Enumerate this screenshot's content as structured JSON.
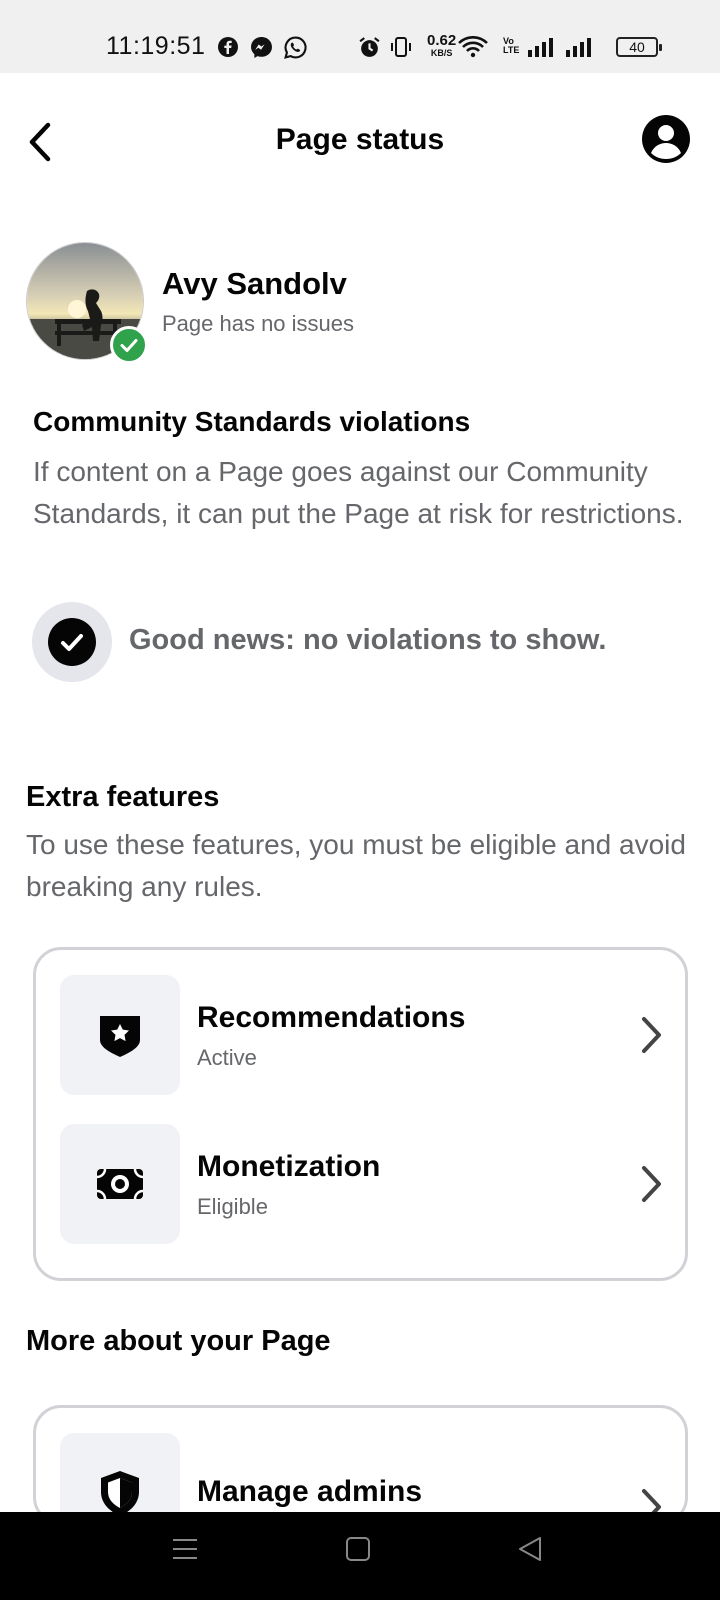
{
  "status_bar": {
    "time": "11:19:51",
    "net_speed_value": "0.62",
    "net_speed_unit": "KB/S",
    "volte_top": "Vo",
    "volte_bottom": "LTE",
    "battery": "40",
    "icons": [
      "facebook-icon",
      "messenger-icon",
      "whatsapp-icon",
      "alarm-icon",
      "vibrate-icon",
      "wifi-icon",
      "signal-icon",
      "signal-icon"
    ]
  },
  "header": {
    "title": "Page status",
    "back_icon": "chevron-left-icon",
    "profile_icon": "account-circle-icon"
  },
  "page": {
    "name": "Avy Sandolv",
    "status": "Page has no issues"
  },
  "community_standards": {
    "title": "Community Standards violations",
    "description": "If content on a Page goes against our Community Standards, it can put the Page at risk for restrictions.",
    "good_news": "Good news: no violations to show."
  },
  "extra_features": {
    "title": "Extra features",
    "description": "To use these features, you must be eligible and avoid breaking any rules.",
    "items": [
      {
        "title": "Recommendations",
        "status": "Active",
        "icon": "star-badge-icon"
      },
      {
        "title": "Monetization",
        "status": "Eligible",
        "icon": "money-icon"
      }
    ]
  },
  "more_about": {
    "title": "More about your Page",
    "items": [
      {
        "title": "Manage admins",
        "icon": "shield-icon"
      }
    ]
  },
  "colors": {
    "success_green": "#31a24c",
    "secondary_text": "#65676b",
    "card_border": "#d0d2d6",
    "icon_tile_bg": "#f0f2f5"
  }
}
